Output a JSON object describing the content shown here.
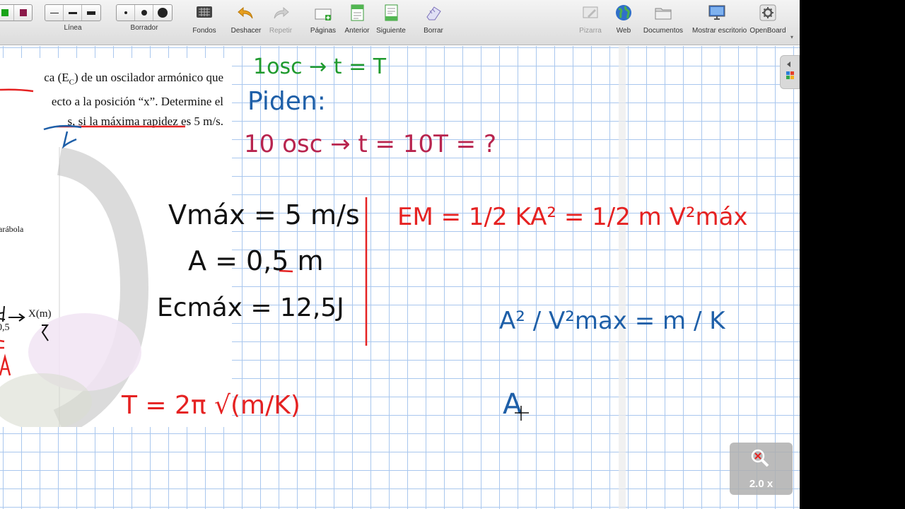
{
  "toolbar": {
    "line": {
      "label": "Línea"
    },
    "eraser": {
      "label": "Borrador"
    },
    "buttons": {
      "backgrounds": "Fondos",
      "undo": "Deshacer",
      "redo": "Repetir",
      "pages": "Páginas",
      "previous": "Anterior",
      "next": "Siguiente",
      "clear": "Borrar",
      "board": "Pizarra",
      "web": "Web",
      "documents": "Documentos",
      "show_desktop": "Mostrar escritorio",
      "openboard": "OpenBoard"
    }
  },
  "document": {
    "line1": "ca (E",
    "line1_sub": "C",
    "line1_rest": ") de un oscilador armónico que",
    "line2": "ecto a la posición “x”. Determine el",
    "line3": "s, si la máxima rapidez es 5 m/s.",
    "graph_label": "arábola",
    "axis_label": "X(m)",
    "axis_value": "0,5"
  },
  "ink": {
    "green_note": "1osc → t = T",
    "piden": "Piden:",
    "ten_osc": "10 osc → t = 10T = ?",
    "vmax": "Vmáx = 5 m/s",
    "amplitude": "A = 0,5 m",
    "ecmax": "Ecmáx = 12,5J",
    "period_formula": "T = 2π √(m/K)",
    "energy_formula": "EM = 1/2 KA² = 1/2 m V²máx",
    "ratio": "A² / V²max = m / K",
    "partial": "A"
  },
  "zoom": {
    "value": "2.0 x"
  }
}
